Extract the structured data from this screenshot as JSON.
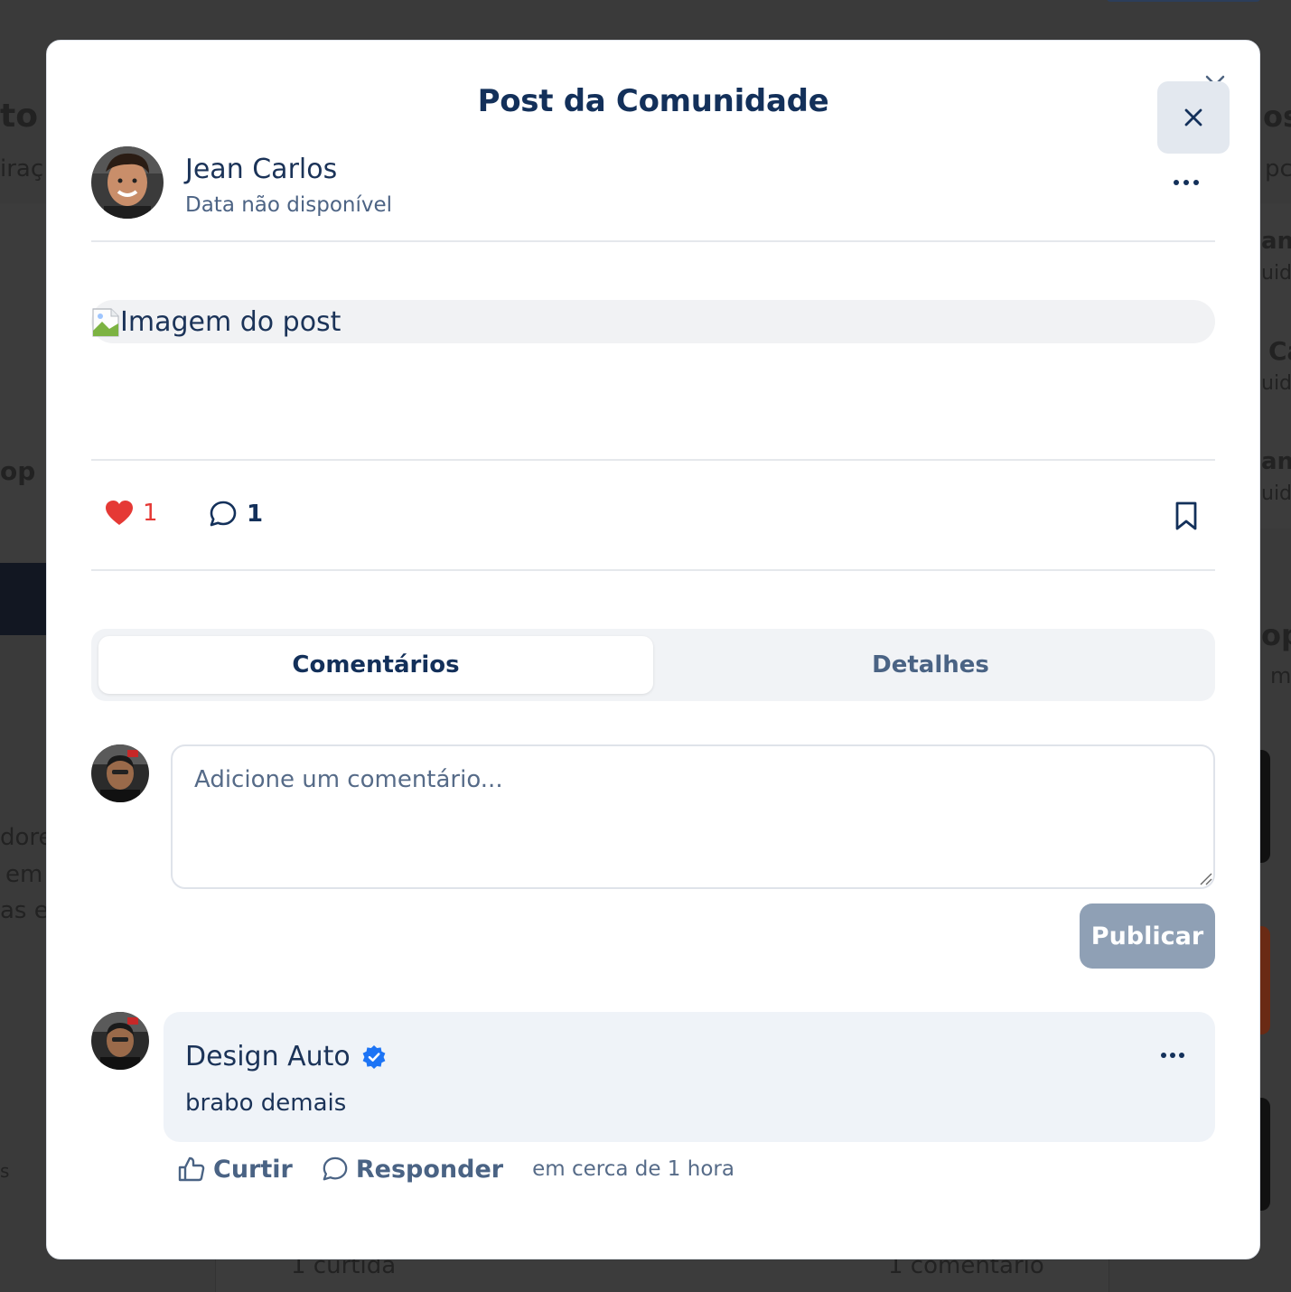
{
  "modal": {
    "title": "Post da Comunidade"
  },
  "post": {
    "author_name": "Jean Carlos",
    "date": "Data não disponível",
    "image_alt": "Imagem do post",
    "likes": "1",
    "comments": "1"
  },
  "tabs": [
    {
      "label": "Comentários",
      "active": true
    },
    {
      "label": "Detalhes",
      "active": false
    }
  ],
  "composer": {
    "placeholder": "Adicione um comentário...",
    "value": "",
    "publish_label": "Publicar"
  },
  "comment": {
    "author": "Design Auto",
    "verified": true,
    "text": "brabo demais",
    "like_label": "Curtir",
    "reply_label": "Responder",
    "time": "em cerca de 1 hora"
  },
  "background": {
    "fragments": [
      "to",
      "iraç",
      "op",
      "dore",
      "em",
      "as e",
      "s",
      "os",
      "pc",
      "an",
      "uid",
      "Ca",
      "uid",
      "an",
      "uid",
      "op",
      "m"
    ],
    "bottom_left": "1 curtida",
    "bottom_right": "1 comentário"
  },
  "colors": {
    "primary": "#13305a",
    "like_red": "#e53935",
    "verified_blue": "#1d74f5",
    "publish_disabled": "#8fa0b5",
    "overlay": "#3a3a3a"
  },
  "icons": [
    "close-icon",
    "more-horizontal-icon",
    "heart-icon",
    "comment-icon",
    "bookmark-icon",
    "verified-icon",
    "thumbs-up-icon",
    "broken-image-icon"
  ]
}
